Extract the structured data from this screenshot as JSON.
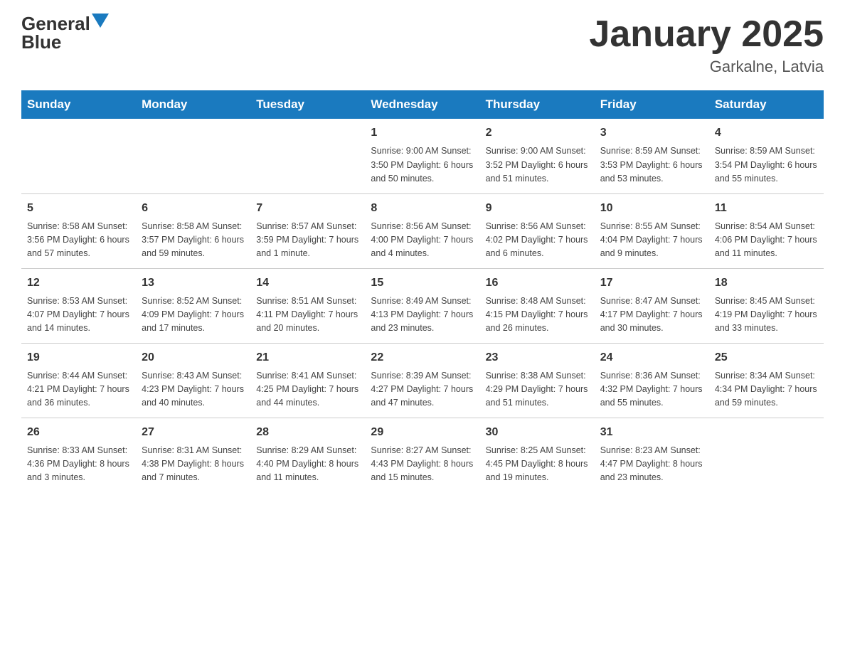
{
  "header": {
    "logo_general": "General",
    "logo_blue": "Blue",
    "calendar_title": "January 2025",
    "calendar_subtitle": "Garkalne, Latvia"
  },
  "weekdays": [
    "Sunday",
    "Monday",
    "Tuesday",
    "Wednesday",
    "Thursday",
    "Friday",
    "Saturday"
  ],
  "weeks": [
    [
      {
        "day": "",
        "info": ""
      },
      {
        "day": "",
        "info": ""
      },
      {
        "day": "",
        "info": ""
      },
      {
        "day": "1",
        "info": "Sunrise: 9:00 AM\nSunset: 3:50 PM\nDaylight: 6 hours\nand 50 minutes."
      },
      {
        "day": "2",
        "info": "Sunrise: 9:00 AM\nSunset: 3:52 PM\nDaylight: 6 hours\nand 51 minutes."
      },
      {
        "day": "3",
        "info": "Sunrise: 8:59 AM\nSunset: 3:53 PM\nDaylight: 6 hours\nand 53 minutes."
      },
      {
        "day": "4",
        "info": "Sunrise: 8:59 AM\nSunset: 3:54 PM\nDaylight: 6 hours\nand 55 minutes."
      }
    ],
    [
      {
        "day": "5",
        "info": "Sunrise: 8:58 AM\nSunset: 3:56 PM\nDaylight: 6 hours\nand 57 minutes."
      },
      {
        "day": "6",
        "info": "Sunrise: 8:58 AM\nSunset: 3:57 PM\nDaylight: 6 hours\nand 59 minutes."
      },
      {
        "day": "7",
        "info": "Sunrise: 8:57 AM\nSunset: 3:59 PM\nDaylight: 7 hours\nand 1 minute."
      },
      {
        "day": "8",
        "info": "Sunrise: 8:56 AM\nSunset: 4:00 PM\nDaylight: 7 hours\nand 4 minutes."
      },
      {
        "day": "9",
        "info": "Sunrise: 8:56 AM\nSunset: 4:02 PM\nDaylight: 7 hours\nand 6 minutes."
      },
      {
        "day": "10",
        "info": "Sunrise: 8:55 AM\nSunset: 4:04 PM\nDaylight: 7 hours\nand 9 minutes."
      },
      {
        "day": "11",
        "info": "Sunrise: 8:54 AM\nSunset: 4:06 PM\nDaylight: 7 hours\nand 11 minutes."
      }
    ],
    [
      {
        "day": "12",
        "info": "Sunrise: 8:53 AM\nSunset: 4:07 PM\nDaylight: 7 hours\nand 14 minutes."
      },
      {
        "day": "13",
        "info": "Sunrise: 8:52 AM\nSunset: 4:09 PM\nDaylight: 7 hours\nand 17 minutes."
      },
      {
        "day": "14",
        "info": "Sunrise: 8:51 AM\nSunset: 4:11 PM\nDaylight: 7 hours\nand 20 minutes."
      },
      {
        "day": "15",
        "info": "Sunrise: 8:49 AM\nSunset: 4:13 PM\nDaylight: 7 hours\nand 23 minutes."
      },
      {
        "day": "16",
        "info": "Sunrise: 8:48 AM\nSunset: 4:15 PM\nDaylight: 7 hours\nand 26 minutes."
      },
      {
        "day": "17",
        "info": "Sunrise: 8:47 AM\nSunset: 4:17 PM\nDaylight: 7 hours\nand 30 minutes."
      },
      {
        "day": "18",
        "info": "Sunrise: 8:45 AM\nSunset: 4:19 PM\nDaylight: 7 hours\nand 33 minutes."
      }
    ],
    [
      {
        "day": "19",
        "info": "Sunrise: 8:44 AM\nSunset: 4:21 PM\nDaylight: 7 hours\nand 36 minutes."
      },
      {
        "day": "20",
        "info": "Sunrise: 8:43 AM\nSunset: 4:23 PM\nDaylight: 7 hours\nand 40 minutes."
      },
      {
        "day": "21",
        "info": "Sunrise: 8:41 AM\nSunset: 4:25 PM\nDaylight: 7 hours\nand 44 minutes."
      },
      {
        "day": "22",
        "info": "Sunrise: 8:39 AM\nSunset: 4:27 PM\nDaylight: 7 hours\nand 47 minutes."
      },
      {
        "day": "23",
        "info": "Sunrise: 8:38 AM\nSunset: 4:29 PM\nDaylight: 7 hours\nand 51 minutes."
      },
      {
        "day": "24",
        "info": "Sunrise: 8:36 AM\nSunset: 4:32 PM\nDaylight: 7 hours\nand 55 minutes."
      },
      {
        "day": "25",
        "info": "Sunrise: 8:34 AM\nSunset: 4:34 PM\nDaylight: 7 hours\nand 59 minutes."
      }
    ],
    [
      {
        "day": "26",
        "info": "Sunrise: 8:33 AM\nSunset: 4:36 PM\nDaylight: 8 hours\nand 3 minutes."
      },
      {
        "day": "27",
        "info": "Sunrise: 8:31 AM\nSunset: 4:38 PM\nDaylight: 8 hours\nand 7 minutes."
      },
      {
        "day": "28",
        "info": "Sunrise: 8:29 AM\nSunset: 4:40 PM\nDaylight: 8 hours\nand 11 minutes."
      },
      {
        "day": "29",
        "info": "Sunrise: 8:27 AM\nSunset: 4:43 PM\nDaylight: 8 hours\nand 15 minutes."
      },
      {
        "day": "30",
        "info": "Sunrise: 8:25 AM\nSunset: 4:45 PM\nDaylight: 8 hours\nand 19 minutes."
      },
      {
        "day": "31",
        "info": "Sunrise: 8:23 AM\nSunset: 4:47 PM\nDaylight: 8 hours\nand 23 minutes."
      },
      {
        "day": "",
        "info": ""
      }
    ]
  ]
}
